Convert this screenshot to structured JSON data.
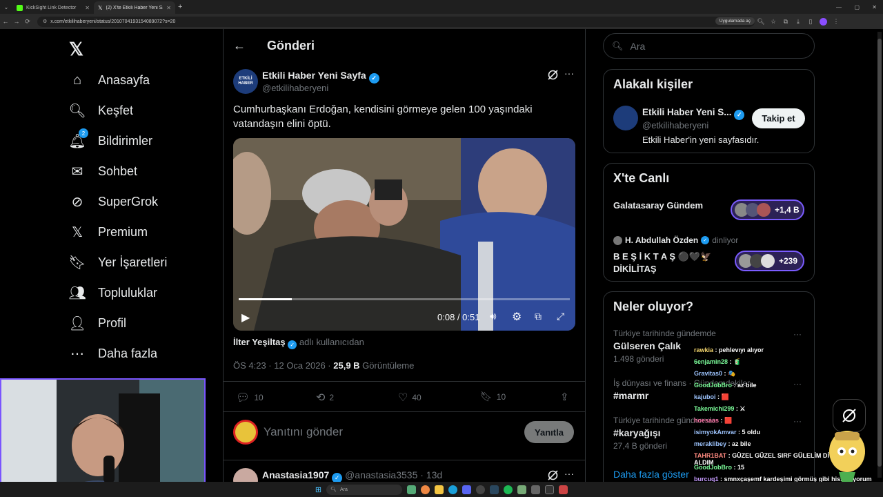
{
  "browser": {
    "tabs": [
      {
        "label": "KickSight Link Detector"
      },
      {
        "label": "(2) X'te Etkili Haber Yeni Sa..."
      }
    ],
    "url": "x.com/etkilihaberyeni/status/2010704193154089072?s=20",
    "url_pill": "Uygulamada aç"
  },
  "sidebar": {
    "items": [
      {
        "label": "Anasayfa",
        "icon": "home-icon"
      },
      {
        "label": "Keşfet",
        "icon": "search-icon"
      },
      {
        "label": "Bildirimler",
        "icon": "bell-icon",
        "badge": "2"
      },
      {
        "label": "Sohbet",
        "icon": "mail-icon"
      },
      {
        "label": "SuperGrok",
        "icon": "grok-icon"
      },
      {
        "label": "Premium",
        "icon": "x-logo-icon"
      },
      {
        "label": "Yer İşaretleri",
        "icon": "bookmark-icon"
      },
      {
        "label": "Topluluklar",
        "icon": "communities-icon"
      },
      {
        "label": "Profil",
        "icon": "profile-icon"
      },
      {
        "label": "Daha fazla",
        "icon": "more-circle-icon"
      }
    ]
  },
  "header": {
    "title": "Gönderi"
  },
  "post": {
    "author_name": "Etkili Haber Yeni Sayfa",
    "author_handle": "@etkilihaberyeni",
    "avatar_text": "ETKİLİ HABER",
    "text": "Cumhurbaşkanı Erdoğan, kendisini görmeye gelen 100 yaşındaki vatandaşın elini öptü.",
    "video": {
      "time": "0:08 / 0:51",
      "progress": 0.16
    },
    "credit_name": "İlter Yeşiltaş",
    "credit_suffix": "adlı kullanıcıdan",
    "timestamp": "ÖS 4:23 · 12 Oca 2026 · ",
    "views_count": "25,9 B",
    "views_label": " Görüntüleme",
    "stats": {
      "replies": "10",
      "reposts": "2",
      "likes": "40",
      "bookmarks": "10"
    }
  },
  "reply_box": {
    "placeholder": "Yanıtını gönder",
    "button": "Yanıtla"
  },
  "next_reply": {
    "name": "Anastasia1907",
    "handle": "@anastasia3535 · 13d"
  },
  "search": {
    "placeholder": "Ara"
  },
  "related": {
    "title": "Alakalı kişiler",
    "name": "Etkili Haber Yeni S...",
    "handle": "@etkilihaberyeni",
    "bio": "Etkili Haber'in yeni sayfasıdır.",
    "follow": "Takip et"
  },
  "live": {
    "title": "X'te Canlı",
    "items": [
      {
        "title": "Galatasaray Gündem",
        "count": "+1,4 B"
      },
      {
        "host": "H. Abdullah Özden",
        "status": "dinliyor",
        "title_line1": "B E Ş İ K T A Ş ⚫🖤🦅",
        "title_line2": "DİKİLİTAŞ",
        "count": "+239"
      }
    ]
  },
  "trends": {
    "title": "Neler oluyor?",
    "items": [
      {
        "context": "Türkiye tarihinde gündemde",
        "name": "Gülseren Çalık",
        "posts": "1.498 gönderi"
      },
      {
        "context": "İş dünyası ve finans · Gündemdekiler",
        "name": "#marmr",
        "posts": ""
      },
      {
        "context": "Türkiye tarihinde gündemde",
        "name": "#karyağışı",
        "posts": "27,4 B gönderi"
      }
    ],
    "show_more": "Daha fazla göster"
  },
  "chat": [
    {
      "user": "rawkia",
      "msg": " : pehlevıyı alıyor",
      "color": "#f5d76e"
    },
    {
      "user": "6enjamin28",
      "msg": " : 🧃",
      "color": "#7cfc9a"
    },
    {
      "user": "Gravitas0",
      "msg": " : 🎭",
      "color": "#9ec5ff"
    },
    {
      "user": "GoodJobBro",
      "msg": " : az bile",
      "color": "#7cfc9a"
    },
    {
      "user": "kajuboi",
      "msg": " : 🟥",
      "color": "#9ec5ff"
    },
    {
      "user": "Takemichi299",
      "msg": " : ⚔",
      "color": "#7cfc9a"
    },
    {
      "user": "hoesaas",
      "msg": " : 🟥",
      "color": "#ff77aa"
    },
    {
      "user": "isimyokAmvar",
      "msg": " : 5 oldu",
      "color": "#9ec5ff"
    },
    {
      "user": "meraklibey",
      "msg": " : az bile",
      "color": "#9ec5ff"
    },
    {
      "user": "TAHR1BAT",
      "msg": " : GÜZEL GÜZEL SIRF GÜLELİM DİYE CAPCUT ALDIM",
      "color": "#ff8a80"
    },
    {
      "user": "GoodJobBro",
      "msg": " : 15",
      "color": "#7cfc9a"
    },
    {
      "user": "burcuq1",
      "msg": " : smnxçaşemf kardeşimi görmüş gibi hissediyorum",
      "color": "#c79bff"
    }
  ],
  "taskbar": {
    "search_placeholder": "Ara"
  },
  "colors": {
    "accent": "#1d9bf0",
    "background": "#000000",
    "border": "#2f3336",
    "muted": "#71767b"
  }
}
